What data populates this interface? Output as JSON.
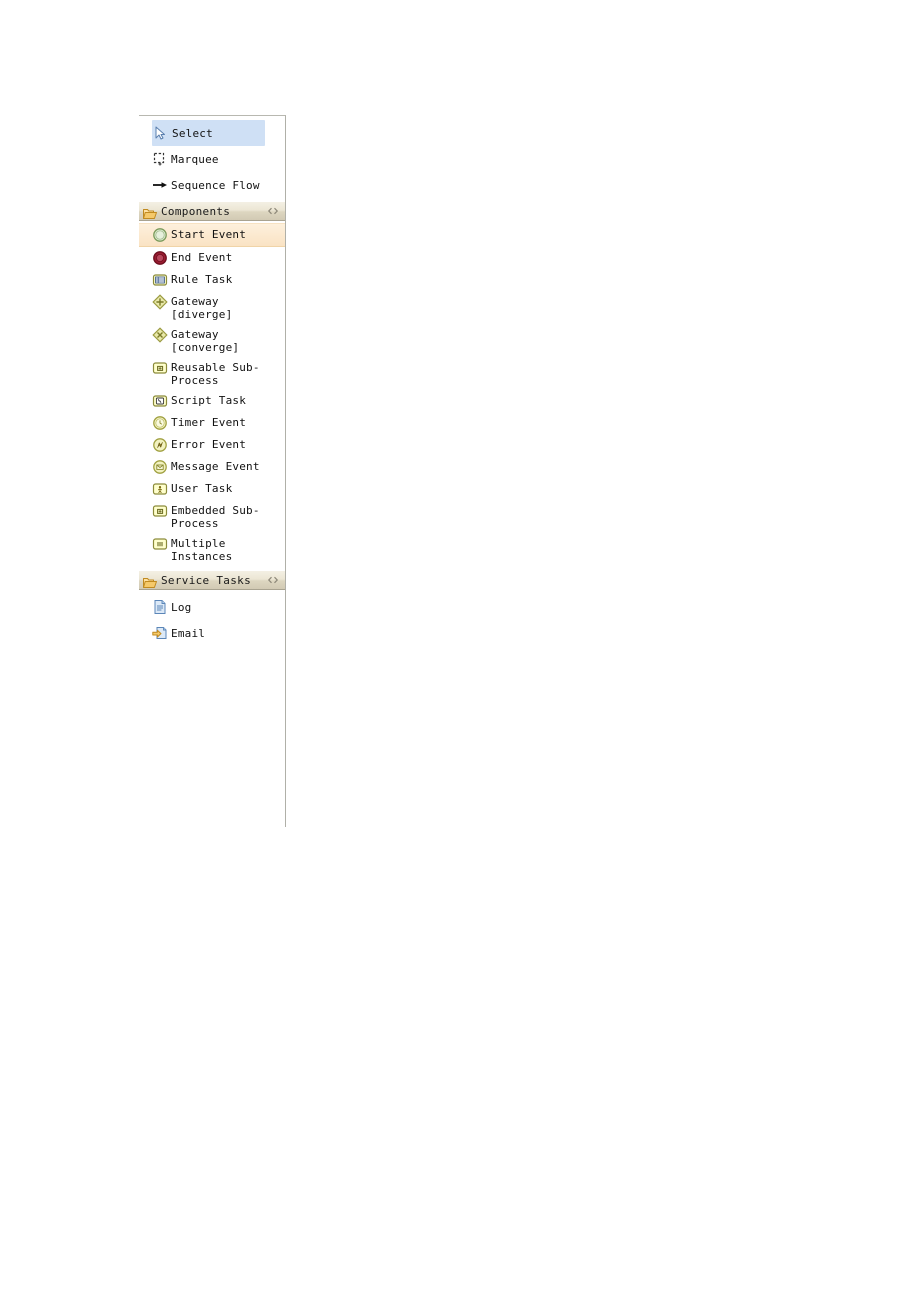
{
  "palette": {
    "tools": [
      {
        "id": "select",
        "label": "Select",
        "icon": "cursor-arrow-icon",
        "state": "selected"
      },
      {
        "id": "marquee",
        "label": "Marquee",
        "icon": "marquee-icon",
        "state": "normal"
      },
      {
        "id": "sequence-flow",
        "label": "Sequence Flow",
        "icon": "arrow-right-icon",
        "state": "normal"
      }
    ],
    "sections": [
      {
        "id": "components",
        "title": "Components",
        "icon": "folder-open-icon",
        "collapse_icon": "collapse-chevrons-icon",
        "items": [
          {
            "id": "start-event",
            "label": "Start Event",
            "icon": "start-event-icon",
            "state": "hovered"
          },
          {
            "id": "end-event",
            "label": "End Event",
            "icon": "end-event-icon",
            "state": "normal"
          },
          {
            "id": "rule-task",
            "label": "Rule Task",
            "icon": "rule-task-icon",
            "state": "normal"
          },
          {
            "id": "gateway-diverge",
            "label": "Gateway\n[diverge]",
            "icon": "gateway-diverge-icon",
            "state": "normal"
          },
          {
            "id": "gateway-converge",
            "label": "Gateway\n[converge]",
            "icon": "gateway-converge-icon",
            "state": "normal"
          },
          {
            "id": "reusable-sub-process",
            "label": "Reusable Sub-\nProcess",
            "icon": "reusable-subprocess-icon",
            "state": "normal"
          },
          {
            "id": "script-task",
            "label": "Script Task",
            "icon": "script-task-icon",
            "state": "normal"
          },
          {
            "id": "timer-event",
            "label": "Timer Event",
            "icon": "timer-event-icon",
            "state": "normal"
          },
          {
            "id": "error-event",
            "label": "Error Event",
            "icon": "error-event-icon",
            "state": "normal"
          },
          {
            "id": "message-event",
            "label": "Message Event",
            "icon": "message-event-icon",
            "state": "normal"
          },
          {
            "id": "user-task",
            "label": "User Task",
            "icon": "user-task-icon",
            "state": "normal"
          },
          {
            "id": "embedded-sub-process",
            "label": "Embedded Sub-\nProcess",
            "icon": "embedded-subprocess-icon",
            "state": "normal"
          },
          {
            "id": "multiple-instances",
            "label": "Multiple\nInstances",
            "icon": "multiple-instances-icon",
            "state": "normal"
          }
        ]
      },
      {
        "id": "service-tasks",
        "title": "Service Tasks",
        "icon": "folder-open-icon",
        "collapse_icon": "collapse-chevrons-icon",
        "items": [
          {
            "id": "log",
            "label": "Log",
            "icon": "log-document-icon",
            "state": "normal"
          },
          {
            "id": "email",
            "label": "Email",
            "icon": "email-icon",
            "state": "normal"
          }
        ]
      }
    ]
  },
  "colors": {
    "selected_highlight": "#cfe0f5",
    "hover_highlight": "#fae3c4",
    "header_gradient_top": "#f4f0e4",
    "header_gradient_bottom": "#d2cab4",
    "panel_border": "#b0b0a8",
    "start_event_fill": "#d8e8cc",
    "start_event_stroke": "#7a9a5a",
    "end_event_fill": "#9b1b30",
    "end_event_stroke": "#6e1020",
    "task_fill": "#ffffcc",
    "task_stroke": "#8a8a3a",
    "gateway_fill": "#e8e8a8",
    "gateway_stroke": "#9a9a40",
    "event_yellow_fill": "#f2f2c0",
    "event_yellow_stroke": "#a0a040",
    "folder_fill": "#f5c96a",
    "folder_stroke": "#c08a20",
    "log_icon_fill": "#dce9f7",
    "log_icon_stroke": "#5b86b8",
    "text": "#111111"
  }
}
